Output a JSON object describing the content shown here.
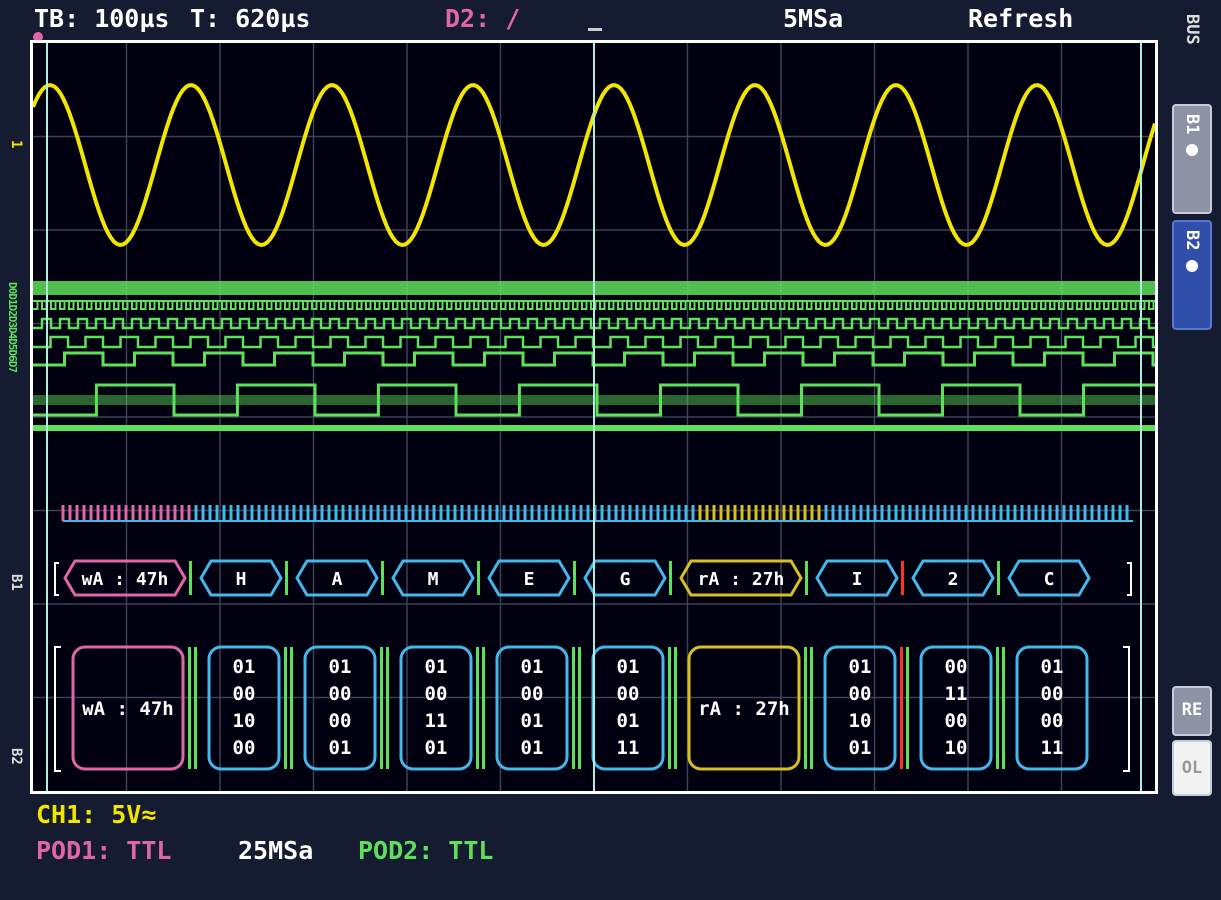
{
  "status_bar": {
    "timebase": "TB: 100µs",
    "trigger_time": "T: 620µs",
    "trigger_source": "D2: /",
    "sample_rate": "5MSa",
    "mode": "Refresh"
  },
  "side_panel": {
    "bus_label": "BUS",
    "bus1_label": "B1",
    "bus2_label": "B2",
    "re_label": "RE",
    "ol_label": "OL"
  },
  "left_markers": {
    "ch1": "1",
    "digital": "D0D1D2D3D4D5D6D7",
    "b1": "B1",
    "b2": "B2"
  },
  "bottom_bar": {
    "ch1": "CH1: 5V≈",
    "pod1": "POD1: TTL",
    "pod_rate": "25MSa",
    "pod2": "POD2: TTL"
  },
  "colors": {
    "background": "#151b30",
    "screen": "#000011",
    "grid": "#3b4354",
    "ch1": "#f2e600",
    "digital": "#5ee05a",
    "pod1": "#e066a8",
    "bus_cyan": "#44b8e8",
    "bus_yellow": "#d8c020",
    "error_red": "#ff3030",
    "cursor": "#aeeedd"
  },
  "bus_b1_frames": [
    {
      "label": "wA : 47h",
      "color": "pod1",
      "w": 120
    },
    {
      "label": "H",
      "color": "bus_cyan",
      "w": 80
    },
    {
      "label": "A",
      "color": "bus_cyan",
      "w": 80
    },
    {
      "label": "M",
      "color": "bus_cyan",
      "w": 80
    },
    {
      "label": "E",
      "color": "bus_cyan",
      "w": 80
    },
    {
      "label": "G",
      "color": "bus_cyan",
      "w": 80
    },
    {
      "label": "rA : 27h",
      "color": "bus_yellow",
      "w": 120
    },
    {
      "label": "I",
      "color": "bus_cyan",
      "w": 80
    },
    {
      "label": "2",
      "color": "bus_cyan",
      "w": 80
    },
    {
      "label": "C",
      "color": "bus_cyan",
      "w": 80
    }
  ],
  "bus_b2_frames": [
    {
      "label": "wA : 47h",
      "color": "pod1",
      "w": 118
    },
    {
      "bits": [
        "01",
        "00",
        "10",
        "00"
      ],
      "color": "bus_cyan",
      "w": 78
    },
    {
      "bits": [
        "01",
        "00",
        "00",
        "01"
      ],
      "color": "bus_cyan",
      "w": 78
    },
    {
      "bits": [
        "01",
        "00",
        "11",
        "01"
      ],
      "color": "bus_cyan",
      "w": 78
    },
    {
      "bits": [
        "01",
        "00",
        "01",
        "01"
      ],
      "color": "bus_cyan",
      "w": 78
    },
    {
      "bits": [
        "01",
        "00",
        "01",
        "11"
      ],
      "color": "bus_cyan",
      "w": 78
    },
    {
      "label": "rA : 27h",
      "color": "bus_yellow",
      "w": 118
    },
    {
      "bits": [
        "01",
        "00",
        "10",
        "01"
      ],
      "color": "bus_cyan",
      "w": 78
    },
    {
      "bits": [
        "00",
        "11",
        "00",
        "10"
      ],
      "color": "bus_cyan",
      "w": 78
    },
    {
      "bits": [
        "01",
        "00",
        "00",
        "11"
      ],
      "color": "bus_cyan",
      "w": 78
    }
  ]
}
